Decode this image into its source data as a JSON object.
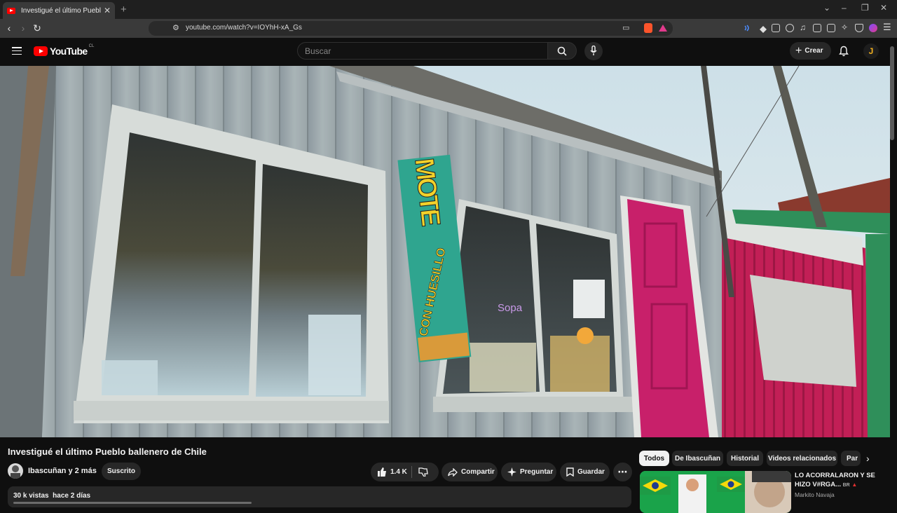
{
  "browser": {
    "tab_title": "Investigué el último Pueblo b",
    "url": "youtube.com/watch?v=IOYhH-xA_Gs"
  },
  "header": {
    "logo_text": "YouTube",
    "country_code": "CL",
    "search_placeholder": "Buscar",
    "create_label": "Crear",
    "avatar_letter": "J"
  },
  "video": {
    "sign_main": "MOTE",
    "sign_sub": "CON HUESILLO",
    "title": "Investigué el último Pueblo ballenero de Chile",
    "channel": "Ibascuñan y 2 más",
    "subscribe_label": "Suscrito",
    "likes": "1.4 K",
    "share_label": "Compartir",
    "ask_label": "Preguntar",
    "save_label": "Guardar",
    "views": "30 k vistas",
    "age": "hace 2 días"
  },
  "sidebar": {
    "chips": [
      "Todos",
      "De Ibascuñan",
      "Historial",
      "Videos relacionados",
      "Par"
    ],
    "recommendation": {
      "title": "LO ACORRALARON Y SE HIZO V#RGA...",
      "badge": "BR",
      "channel": "Markito Navaja"
    }
  },
  "colors": {
    "background": "#0f0f0f",
    "youtube_red": "#ff0000",
    "pill": "#272727",
    "door_magenta": "#c8206a",
    "sign_teal": "#2fa58f",
    "sign_yellow": "#f2d12a"
  }
}
